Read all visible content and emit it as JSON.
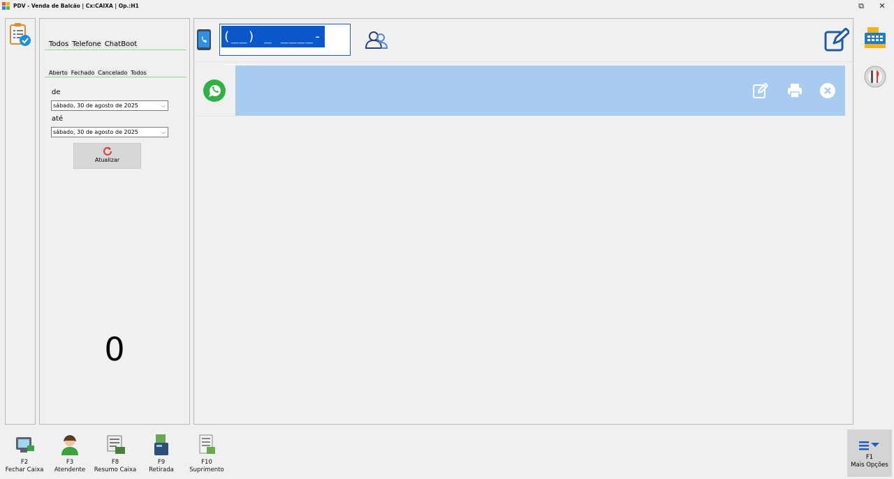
{
  "window": {
    "title": "PDV - Venda de Balcão | Cx:CAIXA | Op.:H1",
    "restore_glyph": "⧉",
    "close_glyph": "✕"
  },
  "filters": {
    "source_tabs": [
      "Todos",
      "Telefone",
      "ChatBoot"
    ],
    "status_tabs": [
      "Aberto",
      "Fechado",
      "Cancelado",
      "Todos"
    ],
    "from_label": "de",
    "from_date": "sábado, 30 de agosto de 2025",
    "to_label": "até",
    "to_date": "sábado, 30 de agosto de 2025",
    "refresh_label": "Atualizar",
    "count": "0"
  },
  "header": {
    "phone_mask": "(__) _ ____-____"
  },
  "footer": {
    "keys": [
      {
        "key": "F2",
        "label": "Fechar Caixa"
      },
      {
        "key": "F3",
        "label": "Atendente"
      },
      {
        "key": "F8",
        "label": "Resumo Caixa"
      },
      {
        "key": "F9",
        "label": "Retirada"
      },
      {
        "key": "F10",
        "label": "Suprimento"
      }
    ],
    "more": {
      "key": "F1",
      "label": "Mais Opções"
    }
  },
  "colors": {
    "accent": "#0a58c9",
    "card": "#a8cbf0",
    "tab_underline": "#8ed88e",
    "whatsapp": "#2fb145"
  }
}
